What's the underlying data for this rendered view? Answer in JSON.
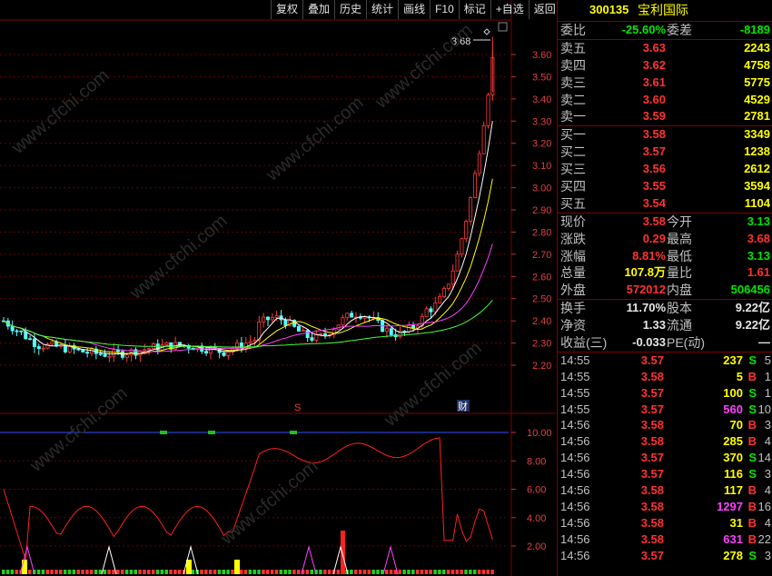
{
  "toolbar": [
    "复权",
    "叠加",
    "历史",
    "统计",
    "画线",
    "F10",
    "标记",
    "+自选",
    "返回"
  ],
  "stock": {
    "code": "300135",
    "name": "宝利国际"
  },
  "commission": {
    "ratio_label": "委比",
    "ratio": "-25.60%",
    "diff_label": "委差",
    "diff": "-8189"
  },
  "asks": [
    {
      "label": "卖五",
      "price": "3.63",
      "vol": "2243"
    },
    {
      "label": "卖四",
      "price": "3.62",
      "vol": "4758"
    },
    {
      "label": "卖三",
      "price": "3.61",
      "vol": "5775"
    },
    {
      "label": "卖二",
      "price": "3.60",
      "vol": "4529"
    },
    {
      "label": "卖一",
      "price": "3.59",
      "vol": "2781"
    }
  ],
  "bids": [
    {
      "label": "买一",
      "price": "3.58",
      "vol": "3349"
    },
    {
      "label": "买二",
      "price": "3.57",
      "vol": "1238"
    },
    {
      "label": "买三",
      "price": "3.56",
      "vol": "2612"
    },
    {
      "label": "买四",
      "price": "3.55",
      "vol": "3594"
    },
    {
      "label": "买五",
      "price": "3.54",
      "vol": "1104"
    }
  ],
  "quote": [
    {
      "l1": "现价",
      "v1": "3.58",
      "c1": "red",
      "l2": "今开",
      "v2": "3.13",
      "c2": "green"
    },
    {
      "l1": "涨跌",
      "v1": "0.29",
      "c1": "red",
      "l2": "最高",
      "v2": "3.68",
      "c2": "red"
    },
    {
      "l1": "涨幅",
      "v1": "8.81%",
      "c1": "red",
      "l2": "最低",
      "v2": "3.13",
      "c2": "green"
    },
    {
      "l1": "总量",
      "v1": "107.8万",
      "c1": "yellow",
      "l2": "量比",
      "v2": "1.61",
      "c2": "red"
    },
    {
      "l1": "外盘",
      "v1": "572012",
      "c1": "red",
      "l2": "内盘",
      "v2": "506456",
      "c2": "green"
    }
  ],
  "stats": [
    {
      "l1": "换手",
      "v1": "11.70%",
      "l2": "股本",
      "v2": "9.22亿"
    },
    {
      "l1": "净资",
      "v1": "1.33",
      "l2": "流通",
      "v2": "9.22亿"
    },
    {
      "l1": "收益(三)",
      "v1": "-0.033",
      "l2": "PE(动)",
      "v2": "—"
    }
  ],
  "ticks": [
    {
      "time": "14:55",
      "price": "3.57",
      "vol": "237",
      "side": "S",
      "count": "5",
      "vc": "yellow"
    },
    {
      "time": "14:55",
      "price": "3.58",
      "vol": "5",
      "side": "B",
      "count": "1",
      "vc": "yellow"
    },
    {
      "time": "14:55",
      "price": "3.57",
      "vol": "100",
      "side": "S",
      "count": "1",
      "vc": "yellow"
    },
    {
      "time": "14:55",
      "price": "3.57",
      "vol": "560",
      "side": "S",
      "count": "10",
      "vc": "magenta"
    },
    {
      "time": "14:56",
      "price": "3.58",
      "vol": "70",
      "side": "B",
      "count": "3",
      "vc": "yellow"
    },
    {
      "time": "14:56",
      "price": "3.58",
      "vol": "285",
      "side": "B",
      "count": "4",
      "vc": "yellow"
    },
    {
      "time": "14:56",
      "price": "3.57",
      "vol": "370",
      "side": "S",
      "count": "14",
      "vc": "yellow"
    },
    {
      "time": "14:56",
      "price": "3.57",
      "vol": "116",
      "side": "S",
      "count": "3",
      "vc": "yellow"
    },
    {
      "time": "14:56",
      "price": "3.58",
      "vol": "117",
      "side": "B",
      "count": "4",
      "vc": "yellow"
    },
    {
      "time": "14:56",
      "price": "3.58",
      "vol": "1297",
      "side": "B",
      "count": "16",
      "vc": "magenta"
    },
    {
      "time": "14:56",
      "price": "3.58",
      "vol": "31",
      "side": "B",
      "count": "4",
      "vc": "yellow"
    },
    {
      "time": "14:56",
      "price": "3.58",
      "vol": "631",
      "side": "B",
      "count": "22",
      "vc": "magenta"
    },
    {
      "time": "14:56",
      "price": "3.57",
      "vol": "278",
      "side": "S",
      "count": "3",
      "vc": "yellow"
    }
  ],
  "chart_data": {
    "type": "candlestick",
    "price_axis": [
      "3.60",
      "3.50",
      "3.40",
      "3.30",
      "3.20",
      "3.10",
      "3.00",
      "2.90",
      "2.80",
      "2.70",
      "2.60",
      "2.50",
      "2.40",
      "2.30",
      "2.20"
    ],
    "indicator_axis": [
      "10.00",
      "8.00",
      "6.00",
      "4.00",
      "2.00"
    ],
    "high_marker": "3.68",
    "markers": [
      "S",
      "财"
    ],
    "ylim": [
      2.16,
      3.72
    ],
    "last_close": 3.58,
    "watermark": "www.cfchi.com"
  }
}
